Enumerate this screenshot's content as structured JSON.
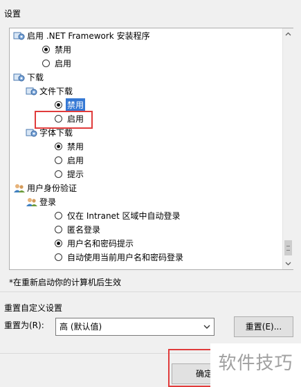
{
  "group_title": "设置",
  "tree": [
    {
      "type": "group",
      "label": "启用 .NET Framework 安装程序",
      "icon": "settings-gear-icon"
    },
    {
      "type": "radio",
      "label": "禁用",
      "checked": true
    },
    {
      "type": "radio",
      "label": "启用",
      "checked": false
    },
    {
      "type": "group",
      "label": "下载",
      "icon": "settings-gear-icon"
    },
    {
      "type": "group",
      "label": "文件下载",
      "icon": "settings-gear-icon"
    },
    {
      "type": "radio",
      "label": "禁用",
      "checked": true,
      "selected": true
    },
    {
      "type": "radio",
      "label": "启用",
      "checked": false
    },
    {
      "type": "group",
      "label": "字体下载",
      "icon": "settings-gear-icon"
    },
    {
      "type": "radio",
      "label": "禁用",
      "checked": true
    },
    {
      "type": "radio",
      "label": "启用",
      "checked": false
    },
    {
      "type": "radio",
      "label": "提示",
      "checked": false
    },
    {
      "type": "group",
      "label": "用户身份验证",
      "icon": "users-icon"
    },
    {
      "type": "group",
      "label": "登录",
      "icon": "users-icon"
    },
    {
      "type": "radio",
      "label": "仅在 Intranet 区域中自动登录",
      "checked": false
    },
    {
      "type": "radio",
      "label": "匿名登录",
      "checked": false
    },
    {
      "type": "radio",
      "label": "用户名和密码提示",
      "checked": true
    },
    {
      "type": "radio",
      "label": "自动使用当前用户名和密码登录",
      "checked": false
    }
  ],
  "note": "*在重新启动你的计算机后生效",
  "reset_section": {
    "title": "重置自定义设置",
    "reset_to_label": "重置为(R):",
    "selected_level": "高 (默认值)",
    "reset_button": "重置(E)..."
  },
  "ok_button": "确定",
  "watermark": "软件技巧",
  "colors": {
    "highlight_box": "#e03b3b",
    "selection": "#3578d4"
  }
}
